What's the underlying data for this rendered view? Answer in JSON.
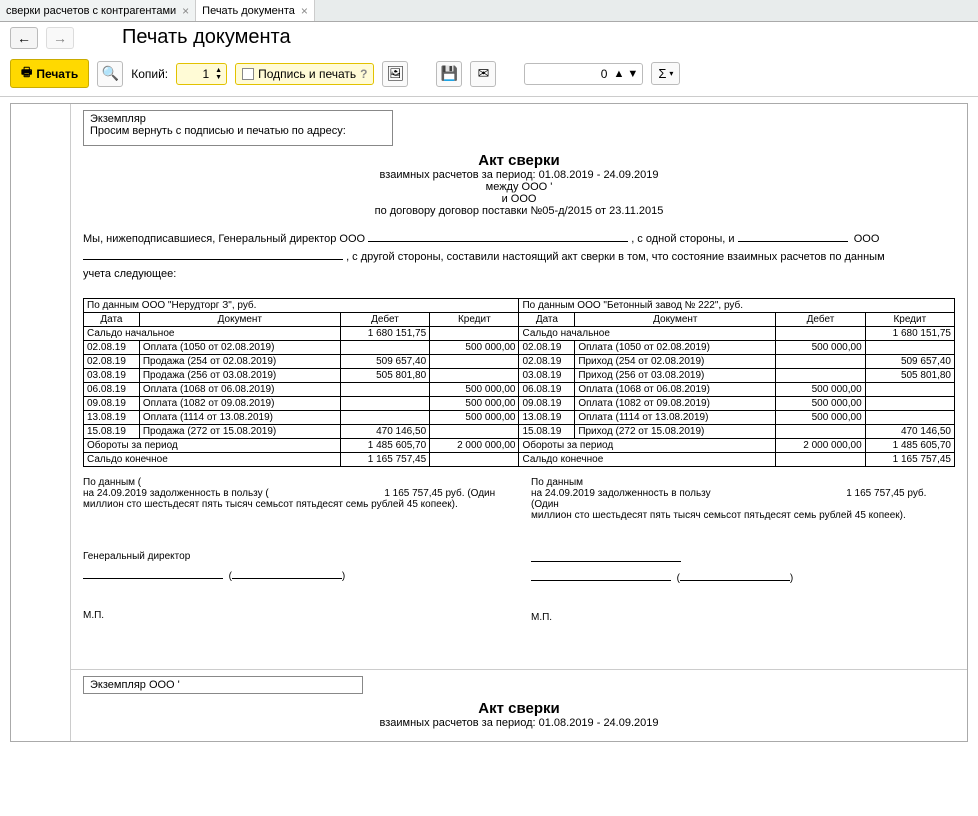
{
  "tabs": [
    {
      "label": "сверки расчетов с контрагентами"
    },
    {
      "label": "Печать документа"
    }
  ],
  "pageTitle": "Печать документа",
  "toolbar": {
    "print": "Печать",
    "copiesLabel": "Копий:",
    "copiesValue": "1",
    "signPrint": "Подпись и печать",
    "numValue": "0"
  },
  "exemplar": {
    "line1": "Экземпляр",
    "line2": "Просим вернуть с подписью и печатью по адресу:"
  },
  "docHeader": {
    "title": "Акт сверки",
    "period": "взаимных расчетов за период: 01.08.2019 - 24.09.2019",
    "between": "между ООО '",
    "and": "и ООО",
    "contract": "по договору договор поставки №05-д/2015 от 23.11.2015"
  },
  "preamble": {
    "p1a": "Мы, нижеподписавшиеся, Генеральный директор ООО",
    "p1b": ", с одной стороны, и",
    "p1c": "ООО",
    "p2a": ", с другой стороны, составили настоящий акт сверки в том, что состояние взаимных расчетов по данным",
    "p3": "учета следующее:"
  },
  "table": {
    "leftHeader": "По данным ООО \"Нерудторг З\", руб.",
    "rightHeader": "По данным ООО \"Бетонный завод № 222\", руб.",
    "cols": {
      "date": "Дата",
      "doc": "Документ",
      "debit": "Дебет",
      "credit": "Кредит"
    },
    "startLabel": "Сальдо начальное",
    "startDebit": "1 680 151,75",
    "startCreditR": "1 680 151,75",
    "rows": [
      {
        "date": "02.08.19",
        "doc": "Оплата (1050 от 02.08.2019)",
        "debit": "",
        "credit": "500 000,00",
        "docR": "Оплата (1050 от 02.08.2019)",
        "debitR": "500 000,00",
        "creditR": ""
      },
      {
        "date": "02.08.19",
        "doc": "Продажа (254 от 02.08.2019)",
        "debit": "509 657,40",
        "credit": "",
        "docR": "Приход (254 от 02.08.2019)",
        "debitR": "",
        "creditR": "509 657,40"
      },
      {
        "date": "03.08.19",
        "doc": "Продажа (256 от 03.08.2019)",
        "debit": "505 801,80",
        "credit": "",
        "docR": "Приход (256 от 03.08.2019)",
        "debitR": "",
        "creditR": "505 801,80"
      },
      {
        "date": "06.08.19",
        "doc": "Оплата (1068 от 06.08.2019)",
        "debit": "",
        "credit": "500 000,00",
        "docR": "Оплата (1068 от 06.08.2019)",
        "debitR": "500 000,00",
        "creditR": ""
      },
      {
        "date": "09.08.19",
        "doc": "Оплата (1082 от 09.08.2019)",
        "debit": "",
        "credit": "500 000,00",
        "docR": "Оплата (1082 от 09.08.2019)",
        "debitR": "500 000,00",
        "creditR": ""
      },
      {
        "date": "13.08.19",
        "doc": "Оплата (1114 от 13.08.2019)",
        "debit": "",
        "credit": "500 000,00",
        "docR": "Оплата (1114 от 13.08.2019)",
        "debitR": "500 000,00",
        "creditR": ""
      },
      {
        "date": "15.08.19",
        "doc": "Продажа (272 от 15.08.2019)",
        "debit": "470 146,50",
        "credit": "",
        "docR": "Приход (272 от 15.08.2019)",
        "debitR": "",
        "creditR": "470 146,50"
      }
    ],
    "turnoverLabel": "Обороты за период",
    "turnoverDebit": "1 485 605,70",
    "turnoverCredit": "2 000 000,00",
    "turnoverDebitR": "2 000 000,00",
    "turnoverCreditR": "1 485 605,70",
    "endLabel": "Сальдо конечное",
    "endDebit": "1 165 757,45",
    "endCreditR": "1 165 757,45"
  },
  "summary": {
    "l1": "По данным (",
    "l2": "на 24.09.2019 задолженность в пользу (",
    "amount": "1 165 757,45 руб. (Один",
    "words": "миллион сто шестьдесят пять тысяч семьсот пятьдесят семь рублей 45 копеек).",
    "r1": "По данным",
    "r2": "на 24.09.2019 задолженность в пользу"
  },
  "signatures": {
    "leftTitle": "Генеральный директор",
    "mp": "М.П."
  },
  "copy2": {
    "exemplar": "Экземпляр ООО '"
  }
}
